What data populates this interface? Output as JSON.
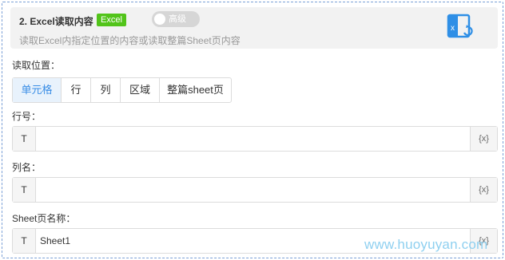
{
  "header": {
    "title": "2. Excel读取内容",
    "badge": "Excel",
    "toggle_label": "高级",
    "description": "读取Excel内指定位置的内容或读取整篇Sheet页内容"
  },
  "read_position": {
    "label": "读取位置：",
    "options": [
      "单元格",
      "行",
      "列",
      "区域",
      "整篇sheet页"
    ],
    "selected": "单元格"
  },
  "row_field": {
    "label": "行号：",
    "prefix": "T",
    "value": "",
    "suffix": "{x}"
  },
  "column_field": {
    "label": "列名：",
    "prefix": "T",
    "value": "",
    "suffix": "{x}"
  },
  "sheet_field": {
    "label": "Sheet页名称：",
    "prefix": "T",
    "value": "Sheet1",
    "suffix": "{x}"
  },
  "watermark": "www.huoyuyan.com",
  "colors": {
    "accent": "#3a8ee6",
    "badge": "#52c41a",
    "toggle": "#d6d6d6",
    "border": "#7a9fd6"
  }
}
